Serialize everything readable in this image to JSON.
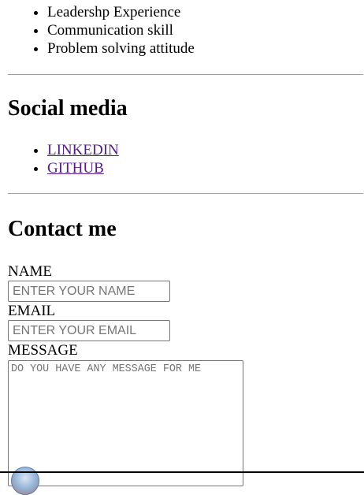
{
  "skills": {
    "items": [
      "Leadershp Experience",
      "Communication skill",
      "Problem solving attitude"
    ]
  },
  "social": {
    "heading": "Social media",
    "links": [
      "LINKEDIN",
      "GITHUB"
    ]
  },
  "contact": {
    "heading": "Contact me",
    "name_label": "NAME",
    "name_placeholder": "ENTER YOUR NAME",
    "email_label": "EMAIL",
    "email_placeholder": "ENTER YOUR EMAIL",
    "message_label": "MESSAGE",
    "message_placeholder": "DO YOU HAVE ANY MESSAGE FOR ME"
  },
  "icons": {
    "bottom_circle": "avatar-circle-icon"
  }
}
